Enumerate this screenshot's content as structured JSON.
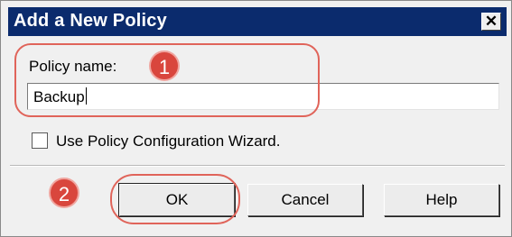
{
  "dialog": {
    "title": "Add a New Policy",
    "close_symbol": "✕"
  },
  "form": {
    "policy_name_label": "Policy name:",
    "policy_name_value": "Backup",
    "wizard_checkbox_label": "Use Policy Configuration Wizard.",
    "wizard_checked": false
  },
  "buttons": {
    "ok": "OK",
    "cancel": "Cancel",
    "help": "Help"
  },
  "annotations": {
    "step1": "1",
    "step2": "2",
    "accent_color": "#d9463d"
  }
}
